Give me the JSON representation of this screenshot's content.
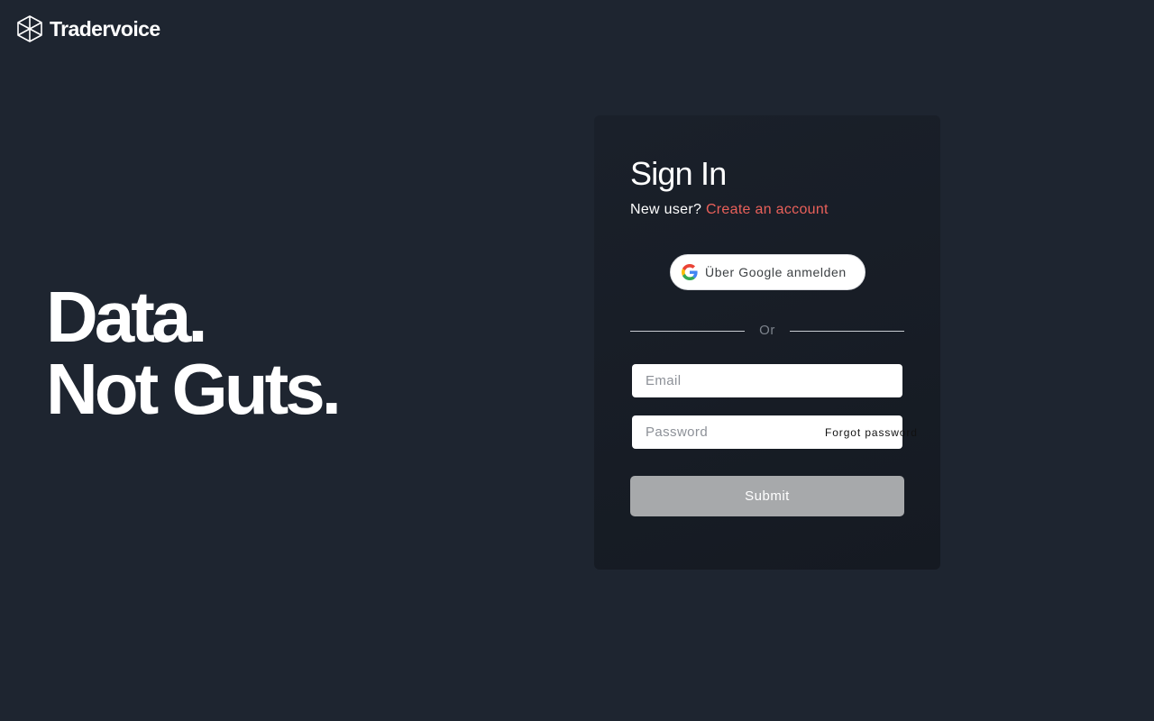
{
  "brand": {
    "name": "Tradervoice",
    "logo_icon": "tradervoice-logo-icon"
  },
  "hero": {
    "line1": "Data.",
    "line2": "Not Guts."
  },
  "signin": {
    "title": "Sign In",
    "new_user_text": "New user?",
    "create_account_link": "Create an account",
    "google_button_label": "Über Google anmelden",
    "google_icon": "google-g-icon",
    "divider_text": "Or",
    "email_placeholder": "Email",
    "email_value": "",
    "password_placeholder": "Password",
    "password_value": "",
    "forgot_password_link": "Forgot password",
    "submit_label": "Submit"
  },
  "colors": {
    "background": "#1e2530",
    "card": "#171c24",
    "link_accent": "#e9605a",
    "submit_disabled": "#a7a9ab"
  }
}
